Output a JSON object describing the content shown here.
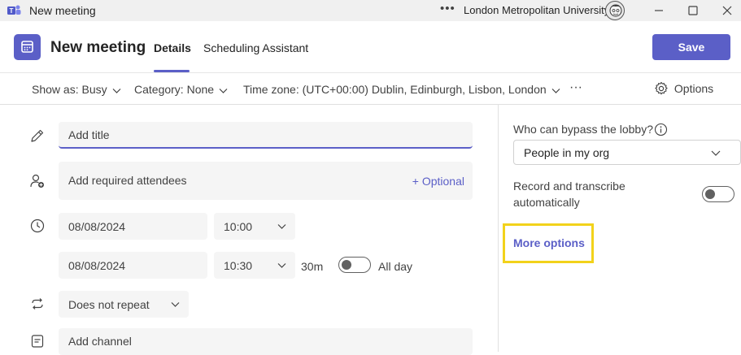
{
  "window": {
    "title": "New meeting",
    "organization": "London Metropolitan University",
    "more_label": "•••"
  },
  "header": {
    "title": "New meeting",
    "tabs": [
      {
        "label": "Details",
        "active": true
      },
      {
        "label": "Scheduling Assistant",
        "active": false
      }
    ],
    "save_label": "Save"
  },
  "toolbar": {
    "show_as": "Show as: Busy",
    "category": "Category: None",
    "time_zone": "Time zone: (UTC+00:00) Dublin, Edinburgh, Lisbon, London",
    "more_label": "···",
    "options_label": "Options"
  },
  "form": {
    "title_placeholder": "Add title",
    "attendees_placeholder": "Add required attendees",
    "optional_label": "+ Optional",
    "start_date": "08/08/2024",
    "start_time": "10:00",
    "end_date": "08/08/2024",
    "end_time": "10:30",
    "duration": "30m",
    "all_day_label": "All day",
    "repeat": "Does not repeat",
    "channel_placeholder": "Add channel"
  },
  "options_pane": {
    "lobby_label": "Who can bypass the lobby?",
    "lobby_value": "People in my org",
    "record_label_line1": "Record and transcribe",
    "record_label_line2": "automatically",
    "more_options_label": "More options"
  },
  "colors": {
    "accent": "#5b5fc7",
    "highlight": "#f2d21b"
  }
}
